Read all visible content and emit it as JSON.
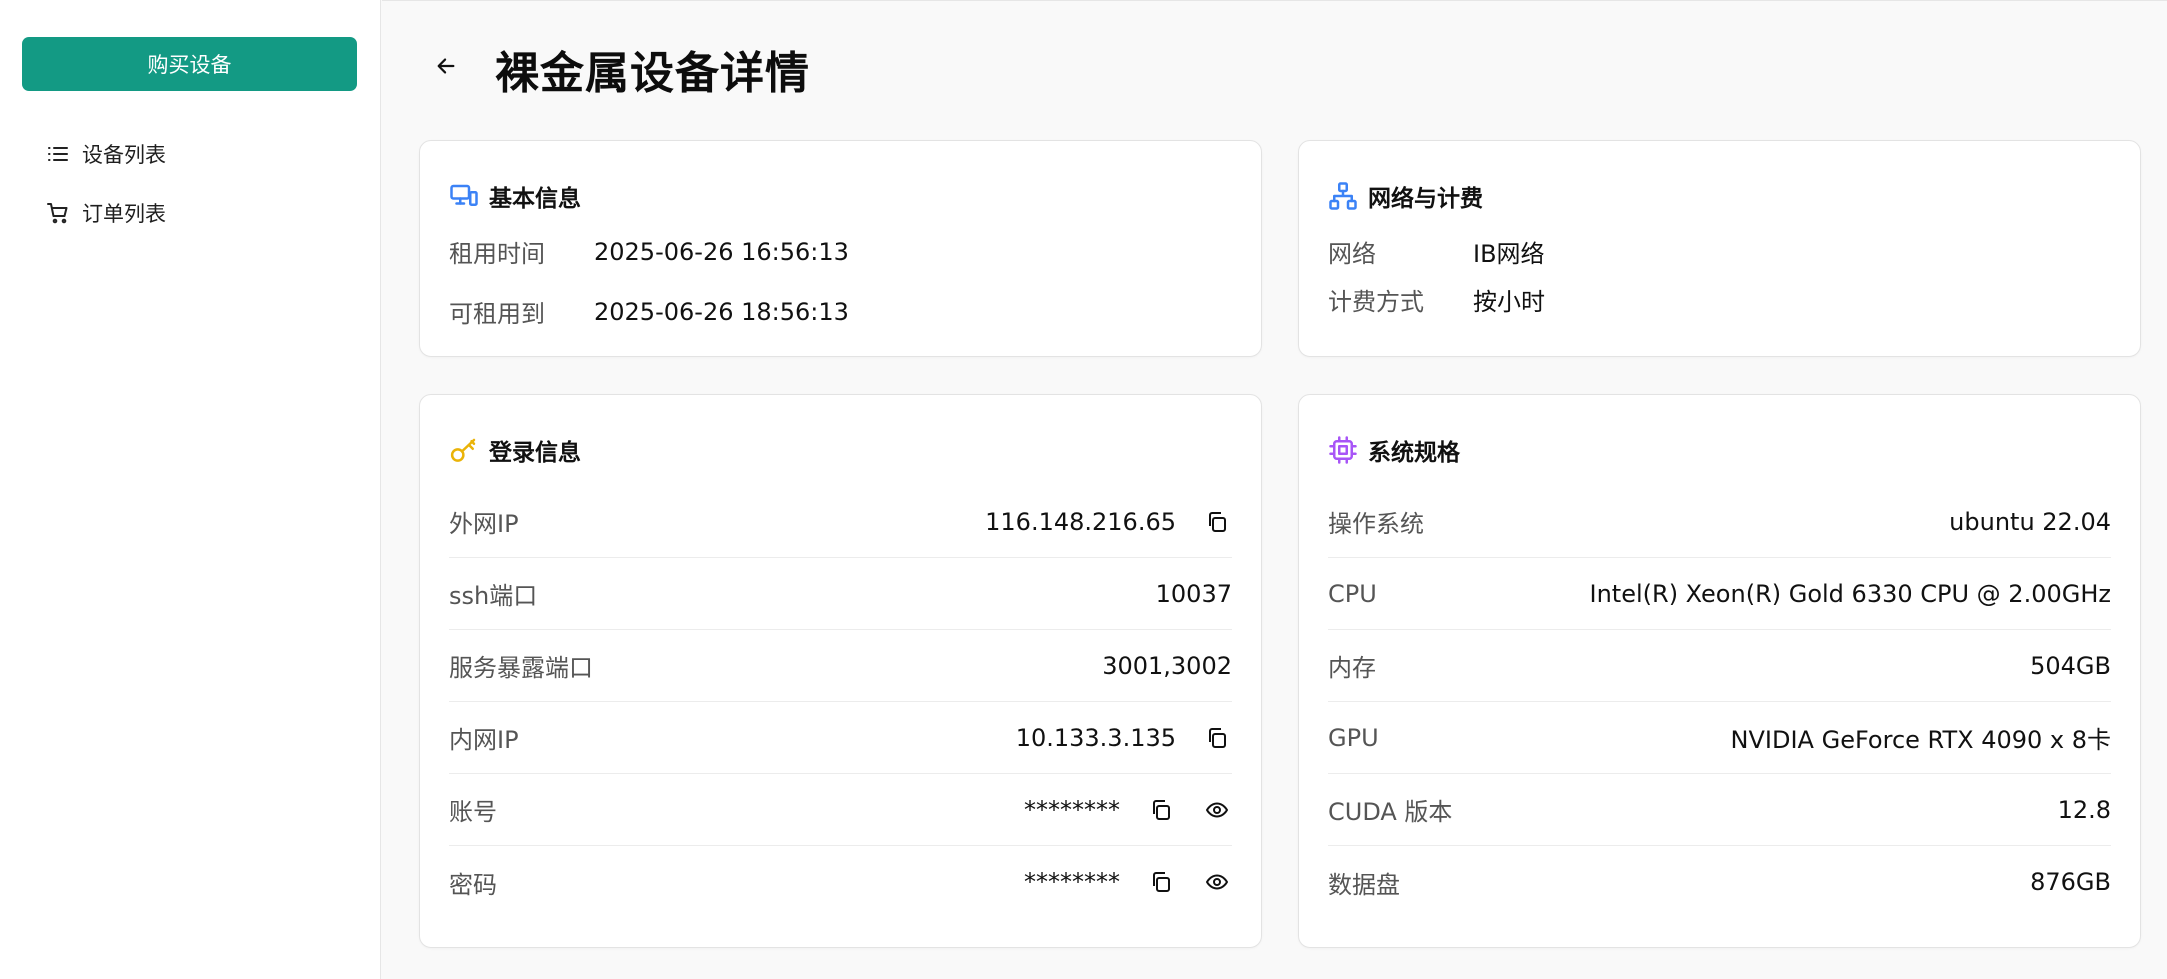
{
  "sidebar": {
    "buy_button": "购买设备",
    "items": [
      {
        "label": "设备列表",
        "icon": "list-icon"
      },
      {
        "label": "订单列表",
        "icon": "cart-icon"
      }
    ]
  },
  "header": {
    "title": "裸金属设备详情"
  },
  "basic_info": {
    "title": "基本信息",
    "rows": [
      {
        "label": "租用时间",
        "value": "2025-06-26 16:56:13"
      },
      {
        "label": "可租用到",
        "value": "2025-06-26 18:56:13"
      }
    ]
  },
  "network_billing": {
    "title": "网络与计费",
    "rows": [
      {
        "label": "网络",
        "value": "IB网络"
      },
      {
        "label": "计费方式",
        "value": "按小时"
      }
    ]
  },
  "login_info": {
    "title": "登录信息",
    "rows": [
      {
        "label": "外网IP",
        "value": "116.148.216.65"
      },
      {
        "label": "ssh端口",
        "value": "10037"
      },
      {
        "label": "服务暴露端口",
        "value": "3001,3002"
      },
      {
        "label": "内网IP",
        "value": "10.133.3.135"
      },
      {
        "label": "账号",
        "value": "********"
      },
      {
        "label": "密码",
        "value": "********"
      }
    ]
  },
  "system_spec": {
    "title": "系统规格",
    "rows": [
      {
        "label": "操作系统",
        "value": "ubuntu 22.04"
      },
      {
        "label": "CPU",
        "value": "Intel(R) Xeon(R) Gold 6330 CPU @ 2.00GHz"
      },
      {
        "label": "内存",
        "value": "504GB"
      },
      {
        "label": "GPU",
        "value": "NVIDIA GeForce RTX 4090 x 8卡"
      },
      {
        "label": "CUDA 版本",
        "value": "12.8"
      },
      {
        "label": "数据盘",
        "value": "876GB"
      }
    ]
  },
  "colors": {
    "accent": "#139a84",
    "basic_icon": "#3b82f6",
    "network_icon": "#3b82f6",
    "login_icon": "#eab308",
    "spec_icon": "#a855f7"
  }
}
